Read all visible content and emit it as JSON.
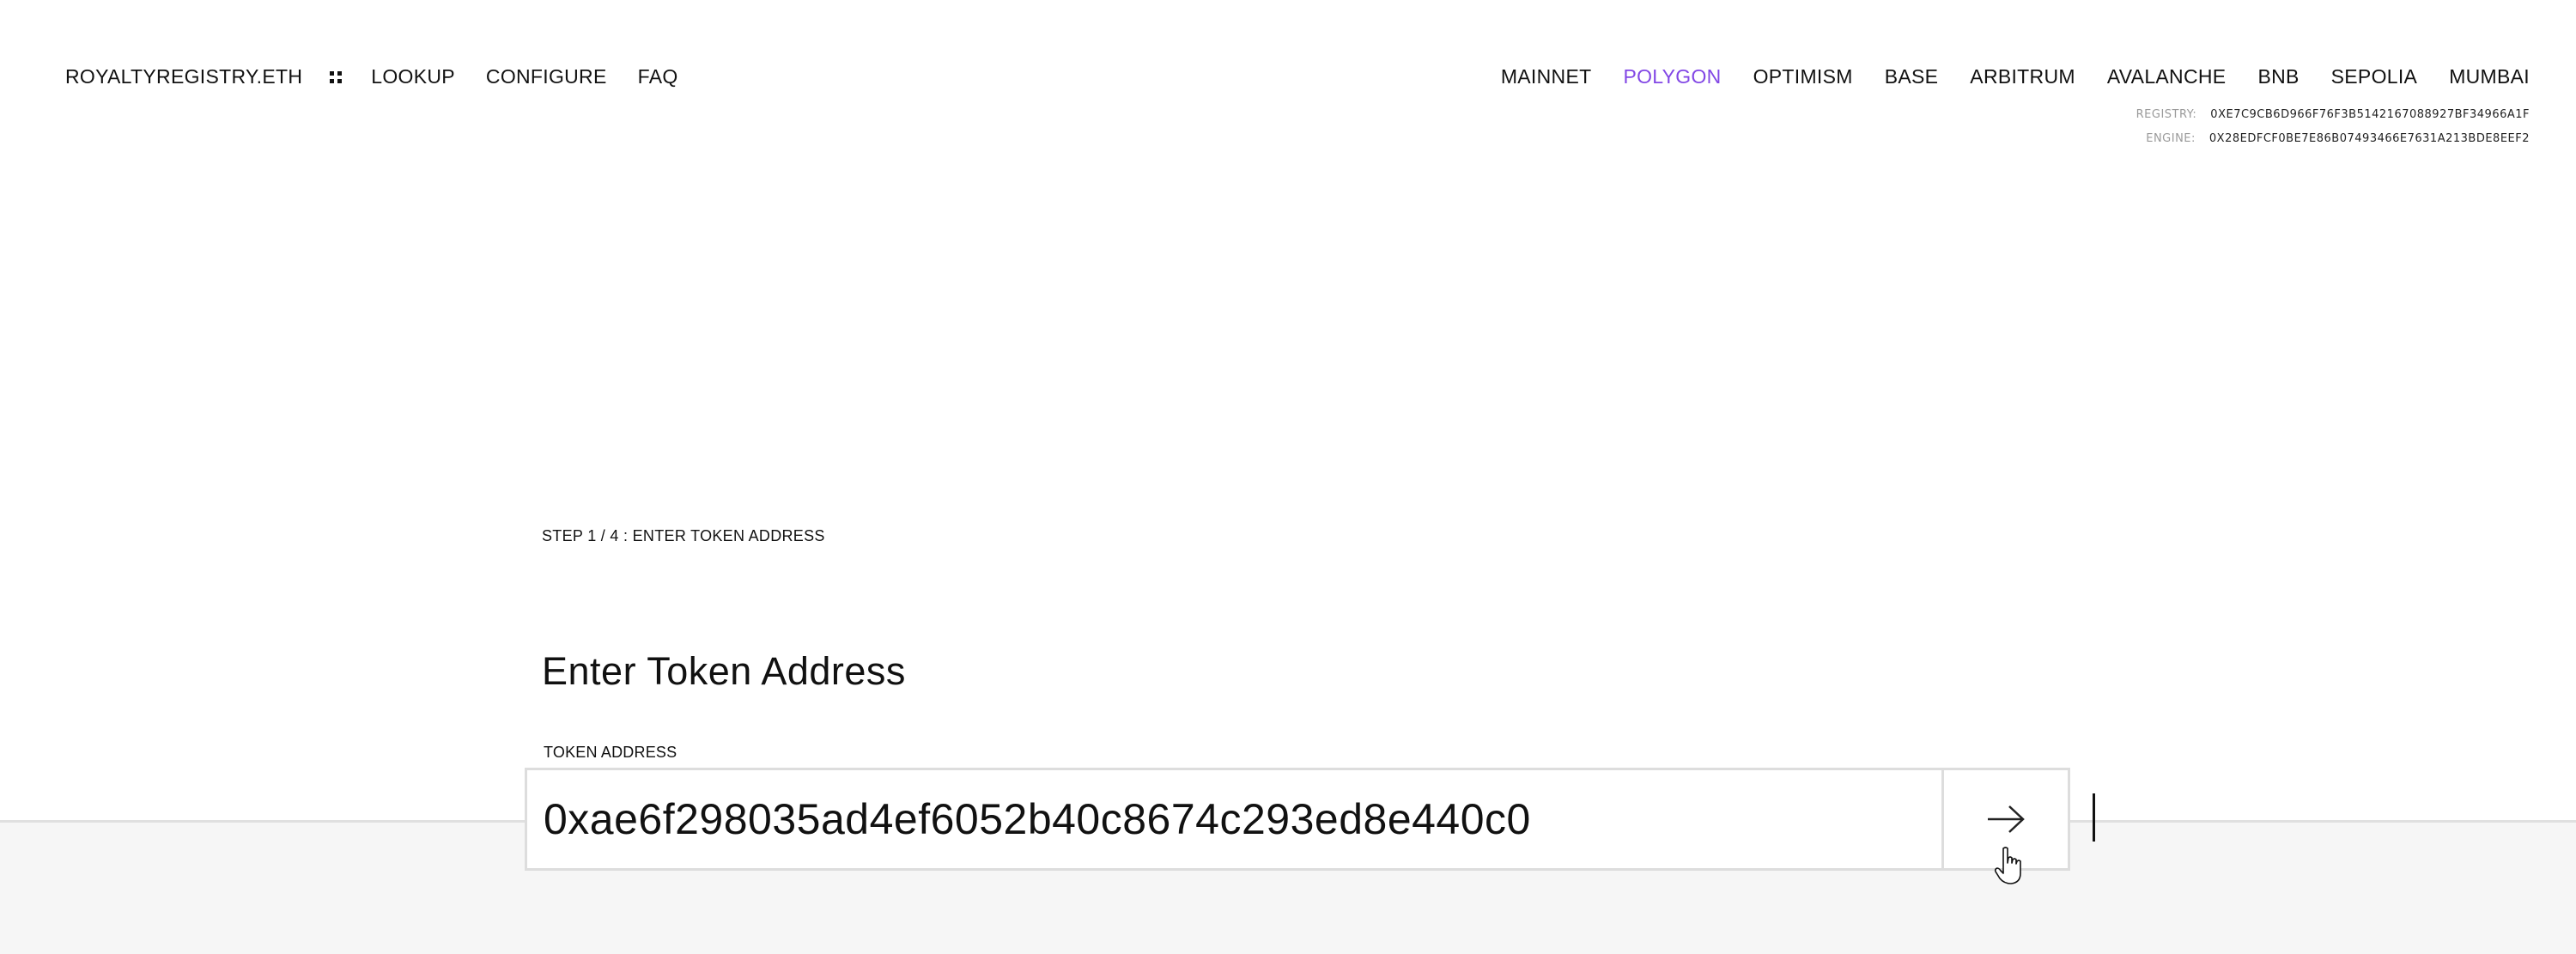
{
  "header": {
    "brand": "ROYALTYREGISTRY.ETH",
    "menu_icon": "grid-dots-icon",
    "nav_links": [
      {
        "label": "LOOKUP"
      },
      {
        "label": "CONFIGURE"
      },
      {
        "label": "FAQ"
      }
    ],
    "networks": [
      {
        "label": "MAINNET",
        "active": false
      },
      {
        "label": "POLYGON",
        "active": true
      },
      {
        "label": "OPTIMISM",
        "active": false
      },
      {
        "label": "BASE",
        "active": false
      },
      {
        "label": "ARBITRUM",
        "active": false
      },
      {
        "label": "AVALANCHE",
        "active": false
      },
      {
        "label": "BNB",
        "active": false
      },
      {
        "label": "SEPOLIA",
        "active": false
      },
      {
        "label": "MUMBAI",
        "active": false
      }
    ],
    "active_color": "#8247e5",
    "contracts": {
      "registry_label": "REGISTRY:",
      "registry_address": "0XE7C9CB6D966F76F3B5142167088927BF34966A1F",
      "engine_label": "ENGINE:",
      "engine_address": "0X28EDFCF0BE7E86B07493466E7631A213BDE8EEF2"
    }
  },
  "main": {
    "step_label": "STEP 1 / 4 : ENTER TOKEN ADDRESS",
    "title": "Enter Token Address",
    "field_label": "TOKEN ADDRESS",
    "token_address_value": "0xae6f298035ad4ef6052b40c8674c293ed8e440c0",
    "submit_icon": "arrow-right-icon"
  }
}
